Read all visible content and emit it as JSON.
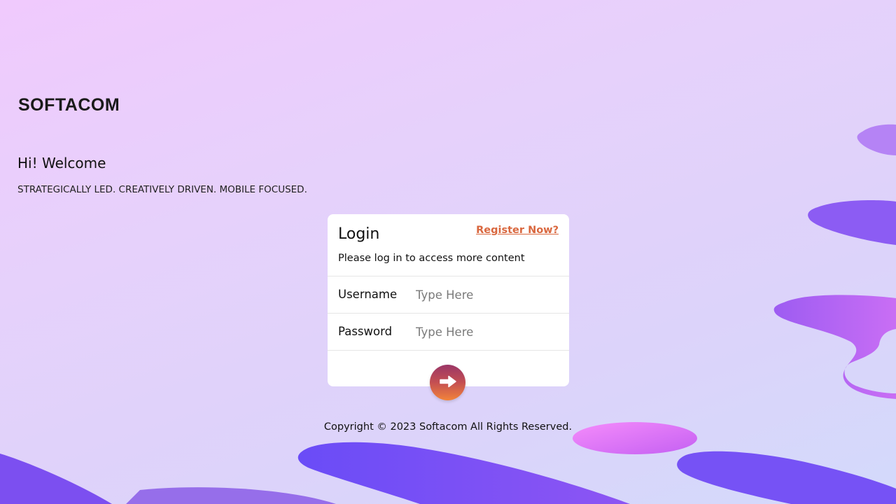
{
  "brand": {
    "name": "SOFTACOM"
  },
  "hero": {
    "greeting": "Hi! Welcome",
    "tagline": "STRATEGICALLY LED. CREATIVELY DRIVEN. MOBILE FOCUSED."
  },
  "login": {
    "title": "Login",
    "register_link": "Register Now?",
    "subtitle": "Please log in to access more content",
    "username": {
      "label": "Username",
      "value": "",
      "placeholder": "Type Here"
    },
    "password": {
      "label": "Password",
      "value": "",
      "placeholder": "Type Here"
    },
    "submit_icon": "arrow-right-icon"
  },
  "footer": {
    "copyright": "Copyright © 2023 Softacom All Rights Reserved."
  },
  "colors": {
    "accent": "#d9673e",
    "button_gradient_top": "#9b3667",
    "button_gradient_bottom": "#f2843a",
    "decor_purple": "#7b4ff5",
    "decor_pink": "#e97ff8"
  }
}
